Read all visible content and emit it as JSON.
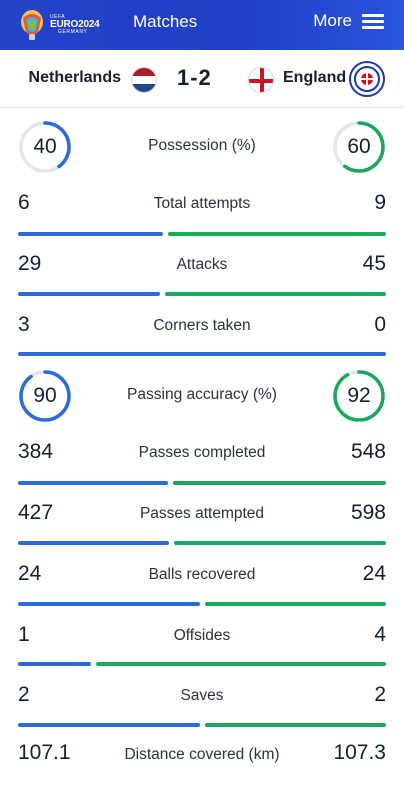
{
  "header": {
    "logo_sub": "UEFA",
    "logo_main": "EURO2024",
    "logo_country": "GERMANY",
    "title": "Matches",
    "more_label": "More",
    "colors": {
      "bar_bg": "#2342c8"
    }
  },
  "match": {
    "home": {
      "name": "Netherlands",
      "flag": "netherlands-flag"
    },
    "away": {
      "name": "England",
      "flag": "england-flag"
    },
    "score": "1-2"
  },
  "colors": {
    "home": "#2a6bd9",
    "away": "#19a85c",
    "track": "#e3e6ec"
  },
  "stats": [
    {
      "label": "Possession (%)",
      "home": "40",
      "away": "60",
      "type": "ring",
      "home_frac": 0.4,
      "away_frac": 0.6
    },
    {
      "label": "Total attempts",
      "home": "6",
      "away": "9",
      "type": "bar",
      "home_num": 6,
      "away_num": 9
    },
    {
      "label": "Attacks",
      "home": "29",
      "away": "45",
      "type": "bar",
      "home_num": 29,
      "away_num": 45
    },
    {
      "label": "Corners taken",
      "home": "3",
      "away": "0",
      "type": "bar",
      "home_num": 3,
      "away_num": 0
    },
    {
      "label": "Passing accuracy (%)",
      "home": "90",
      "away": "92",
      "type": "ring",
      "home_frac": 0.9,
      "away_frac": 0.92
    },
    {
      "label": "Passes completed",
      "home": "384",
      "away": "548",
      "type": "bar",
      "home_num": 384,
      "away_num": 548
    },
    {
      "label": "Passes attempted",
      "home": "427",
      "away": "598",
      "type": "bar",
      "home_num": 427,
      "away_num": 598
    },
    {
      "label": "Balls recovered",
      "home": "24",
      "away": "24",
      "type": "bar",
      "home_num": 24,
      "away_num": 24
    },
    {
      "label": "Offsides",
      "home": "1",
      "away": "4",
      "type": "bar",
      "home_num": 1,
      "away_num": 4
    },
    {
      "label": "Saves",
      "home": "2",
      "away": "2",
      "type": "bar",
      "home_num": 2,
      "away_num": 2
    },
    {
      "label": "Distance covered (km)",
      "home": "107.1",
      "away": "107.3",
      "type": "bar",
      "home_num": 107.1,
      "away_num": 107.3
    }
  ]
}
